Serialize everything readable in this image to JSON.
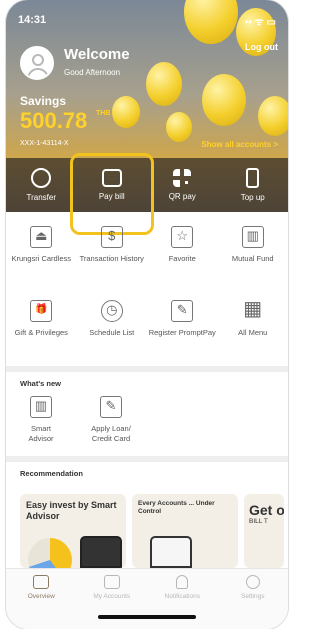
{
  "status": {
    "time": "14:31",
    "icons": "▪▪ ᯤ ▭"
  },
  "header": {
    "welcome": "Welcome",
    "greeting": "Good Afternoon",
    "logout": "Log out"
  },
  "account": {
    "type": "Savings",
    "balance": "500.78",
    "currency": "THB",
    "number": "XXX-1-43114-X",
    "show_all": "Show all accounts >"
  },
  "actions": [
    {
      "label": "Transfer",
      "icon": "transfer-icon"
    },
    {
      "label": "Pay bill",
      "icon": "bill-icon"
    },
    {
      "label": "QR pay",
      "icon": "qr-icon"
    },
    {
      "label": "Top up",
      "icon": "phone-icon"
    }
  ],
  "menu": [
    {
      "label": "Krungsri Cardless",
      "icon": "atm-icon",
      "glyph": "⏏"
    },
    {
      "label": "Transaction History",
      "icon": "history-icon",
      "glyph": "$"
    },
    {
      "label": "Favorite",
      "icon": "favorite-icon",
      "glyph": "☆"
    },
    {
      "label": "Mutual Fund",
      "icon": "fund-icon",
      "glyph": "▥"
    },
    {
      "label": "Gift & Privileges",
      "icon": "gift-icon",
      "glyph": "🎁"
    },
    {
      "label": "Schedule List",
      "icon": "clock-icon",
      "glyph": "◷"
    },
    {
      "label": "Register PromptPay",
      "icon": "promptpay-icon",
      "glyph": "✎"
    },
    {
      "label": "All Menu",
      "icon": "grid-icon",
      "glyph": "▦"
    }
  ],
  "whats_new": {
    "title": "What's new",
    "items": [
      {
        "label": "Smart Advisor",
        "icon": "advisor-icon",
        "glyph": "▥"
      },
      {
        "label": "Apply Loan/ Credit Card",
        "icon": "loan-icon",
        "glyph": "✎"
      }
    ]
  },
  "recommendation": {
    "title": "Recommendation",
    "cards": [
      {
        "title": "Easy invest by Smart Advisor"
      },
      {
        "title": "Every Accounts ... Under Control"
      },
      {
        "title": "Get or",
        "sub": "BILL T"
      }
    ]
  },
  "tabs": [
    {
      "label": "Overview",
      "active": true
    },
    {
      "label": "My Accounts"
    },
    {
      "label": "Notifications"
    },
    {
      "label": "Settings"
    }
  ],
  "colors": {
    "accent": "#ffd12b",
    "highlight": "#f2c31e",
    "active_tab": "#8a7a63"
  }
}
